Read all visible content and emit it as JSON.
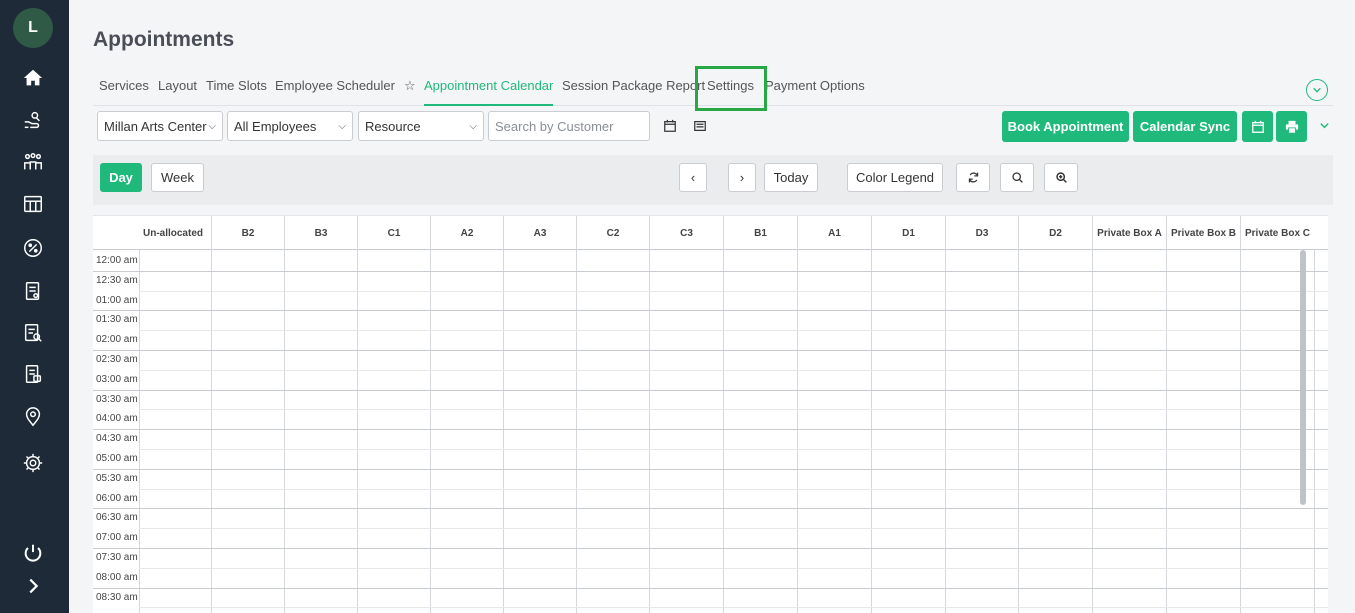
{
  "user": {
    "initial": "L"
  },
  "page": {
    "title": "Appointments"
  },
  "tabs": [
    {
      "label": "Services",
      "active": false
    },
    {
      "label": "Layout",
      "active": false
    },
    {
      "label": "Time Slots",
      "active": false
    },
    {
      "label": "Employee Scheduler",
      "active": false
    },
    {
      "label": "Appointment Calendar",
      "active": true
    },
    {
      "label": "Session Package Report",
      "active": false
    },
    {
      "label": "Settings",
      "active": false
    },
    {
      "label": "Payment Options",
      "active": false
    }
  ],
  "filters": {
    "location": "Millan Arts Center",
    "employees": "All Employees",
    "resource": "Resource",
    "search_placeholder": "Search by Customer"
  },
  "actions": {
    "book": "Book Appointment",
    "sync": "Calendar Sync"
  },
  "calendar_toolbar": {
    "day": "Day",
    "week": "Week",
    "prev": "‹",
    "next": "›",
    "today": "Today",
    "legend": "Color Legend"
  },
  "columns": [
    "Un-allocated",
    "B2",
    "B3",
    "C1",
    "A2",
    "A3",
    "C2",
    "C3",
    "B1",
    "A1",
    "D1",
    "D3",
    "D2",
    "Private Box A",
    "Private Box B",
    "Private Box C"
  ],
  "time_slots": [
    "12:00 am",
    "12:30 am",
    "01:00 am",
    "01:30 am",
    "02:00 am",
    "02:30 am",
    "03:00 am",
    "03:30 am",
    "04:00 am",
    "04:30 am",
    "05:00 am",
    "05:30 am",
    "06:00 am",
    "06:30 am",
    "07:00 am",
    "07:30 am",
    "08:00 am",
    "08:30 am"
  ],
  "colors": {
    "accent": "#20b97c",
    "sidebar": "#1e2a38",
    "highlight": "#28a745"
  }
}
